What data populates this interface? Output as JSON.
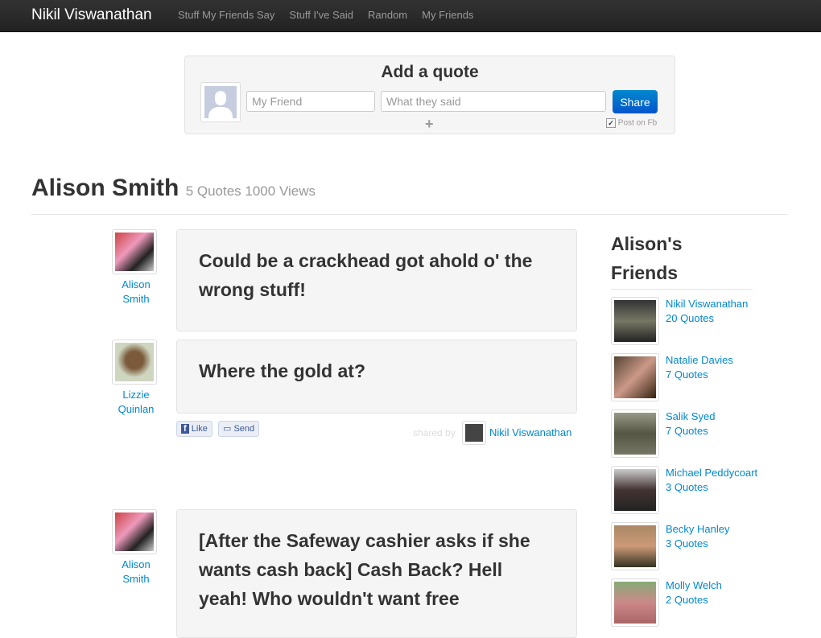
{
  "nav": {
    "brand": "Nikil Viswanathan",
    "links": [
      "Stuff My Friends Say",
      "Stuff I've Said",
      "Random",
      "My Friends"
    ]
  },
  "add": {
    "title": "Add a quote",
    "friend_placeholder": "My Friend",
    "quote_placeholder": "What they said",
    "share": "Share",
    "plus": "+",
    "post_fb": "Post on Fb"
  },
  "profile": {
    "name": "Alison Smith",
    "stats": "5 Quotes 1000 Views"
  },
  "quotes": [
    {
      "author_first": "Alison",
      "author_last": "Smith",
      "text": "Could be a crackhead got ahold o' the wrong stuff!"
    },
    {
      "author_first": "Lizzie",
      "author_last": "Quinlan",
      "text": "Where the gold at?",
      "like": "Like",
      "send": "Send",
      "shared_by_label": "shared by",
      "shared_by": "Nikil Viswanathan"
    },
    {
      "author_first": "Alison",
      "author_last": "Smith",
      "text": "[After the Safeway cashier asks if she wants cash back] Cash Back? Hell yeah! Who wouldn't want free"
    }
  ],
  "friends": {
    "title": "Alison's Friends",
    "items": [
      {
        "name": "Nikil Viswanathan",
        "quotes": "20 Quotes"
      },
      {
        "name": "Natalie Davies",
        "quotes": "7 Quotes"
      },
      {
        "name": "Salik Syed",
        "quotes": "7 Quotes"
      },
      {
        "name": "Michael Peddycoart",
        "quotes": "3 Quotes"
      },
      {
        "name": "Becky Hanley",
        "quotes": "3 Quotes"
      },
      {
        "name": "Molly Welch",
        "quotes": "2 Quotes"
      }
    ]
  }
}
